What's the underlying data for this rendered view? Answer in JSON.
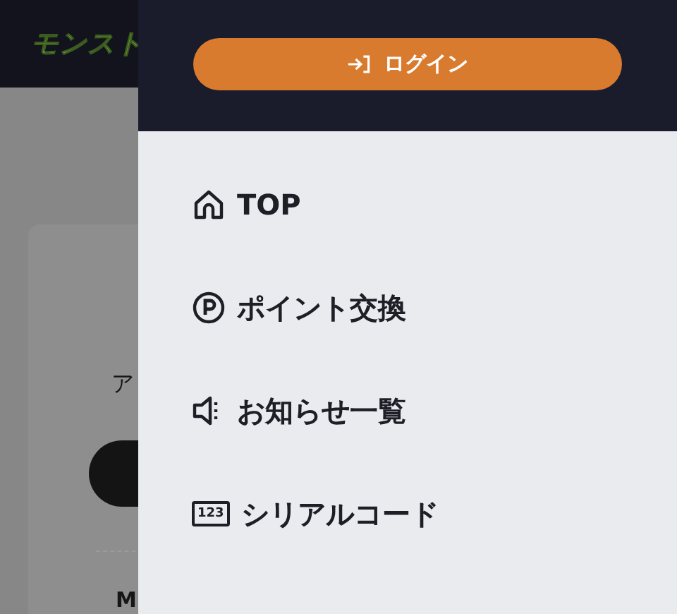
{
  "background": {
    "logo": "モンスト",
    "card_heading": "ア",
    "card_footer": "M"
  },
  "drawer": {
    "login_button": "ログイン",
    "menu": [
      {
        "kind": "home",
        "label": "TOP"
      },
      {
        "kind": "point",
        "label": "ポイント交換"
      },
      {
        "kind": "speaker",
        "label": "お知らせ一覧"
      },
      {
        "kind": "serial",
        "label": "シリアルコード",
        "icon_text": "123"
      }
    ]
  }
}
